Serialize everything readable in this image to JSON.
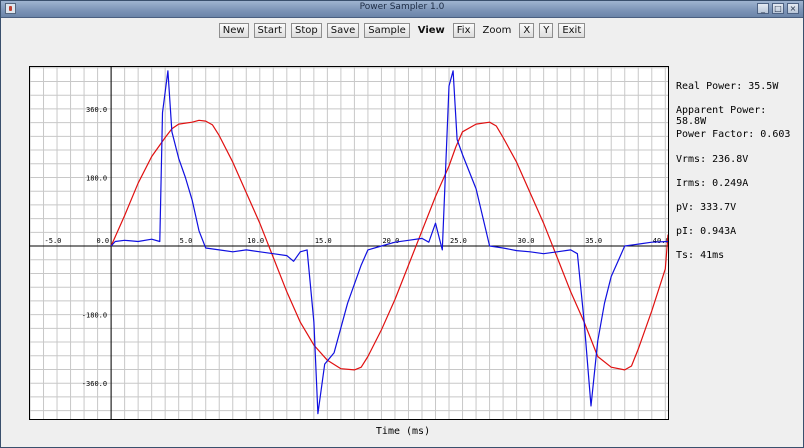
{
  "window": {
    "title": "Power Sampler 1.0",
    "minimize": "_",
    "maximize": "□",
    "close": "×"
  },
  "toolbar": {
    "new": "New",
    "start": "Start",
    "stop": "Stop",
    "save": "Save",
    "sample": "Sample",
    "view_label": "View",
    "fix": "Fix",
    "zoom_label": "Zoom",
    "x": "X",
    "y": "Y",
    "exit": "Exit"
  },
  "readouts": {
    "real_power": "Real Power: 35.5W",
    "apparent_power": "Apparent Power: 58.8W",
    "power_factor": "Power Factor: 0.603",
    "vrms": "Vrms: 236.8V",
    "irms": "Irms: 0.249A",
    "pv": "pV: 333.7V",
    "pi": "pI: 0.943A",
    "ts": "Ts: 41ms"
  },
  "chart_data": {
    "type": "line",
    "xlabel": "Time (ms)",
    "xlim": [
      -6,
      41.2
    ],
    "ylim": [
      -454,
      470
    ],
    "x_ticks": [
      -5,
      0,
      5,
      10,
      15,
      20,
      25,
      30,
      35,
      40
    ],
    "x_tick_labels": [
      "-5.0",
      "0.0",
      "5.0",
      "10.0",
      "15.0",
      "20.0",
      "25.0",
      "30.0",
      "35.0",
      "40.0"
    ],
    "y_ticks": [
      360,
      180,
      -180,
      -360
    ],
    "y_tick_labels": [
      "360.0",
      "180.0",
      "-180.0",
      "-360.0"
    ],
    "origin_label": "0.0",
    "grid": true,
    "series": [
      {
        "color": "#e01010",
        "points": [
          [
            0,
            0
          ],
          [
            1.0,
            80
          ],
          [
            2.0,
            165
          ],
          [
            3.0,
            235
          ],
          [
            4.0,
            285
          ],
          [
            4.5,
            308
          ],
          [
            5.0,
            320
          ],
          [
            6.0,
            325
          ],
          [
            6.5,
            330
          ],
          [
            7.0,
            328
          ],
          [
            7.5,
            318
          ],
          [
            8.0,
            290
          ],
          [
            9.0,
            220
          ],
          [
            10.0,
            140
          ],
          [
            11.0,
            60
          ],
          [
            12.0,
            -30
          ],
          [
            13.0,
            -120
          ],
          [
            14.0,
            -200
          ],
          [
            15.0,
            -260
          ],
          [
            16.0,
            -300
          ],
          [
            17.0,
            -322
          ],
          [
            18.0,
            -325
          ],
          [
            18.5,
            -318
          ],
          [
            19.0,
            -290
          ],
          [
            20.0,
            -220
          ],
          [
            21.0,
            -140
          ],
          [
            22.0,
            -50
          ],
          [
            23.0,
            40
          ],
          [
            24.0,
            130
          ],
          [
            25.0,
            210
          ],
          [
            25.5,
            260
          ],
          [
            26.0,
            300
          ],
          [
            27.0,
            320
          ],
          [
            28.0,
            325
          ],
          [
            28.5,
            315
          ],
          [
            29.0,
            285
          ],
          [
            30.0,
            220
          ],
          [
            31.0,
            140
          ],
          [
            32.0,
            60
          ],
          [
            33.0,
            -30
          ],
          [
            34.0,
            -120
          ],
          [
            35.0,
            -200
          ],
          [
            35.5,
            -245
          ],
          [
            36.0,
            -290
          ],
          [
            37.0,
            -318
          ],
          [
            38.0,
            -325
          ],
          [
            38.5,
            -315
          ],
          [
            39.0,
            -270
          ],
          [
            40.0,
            -170
          ],
          [
            41.0,
            -60
          ],
          [
            41.2,
            30
          ]
        ]
      },
      {
        "color": "#1010e0",
        "points": [
          [
            0,
            0
          ],
          [
            0.3,
            12
          ],
          [
            1.0,
            15
          ],
          [
            2.0,
            12
          ],
          [
            3.0,
            18
          ],
          [
            3.6,
            12
          ],
          [
            3.8,
            350
          ],
          [
            4.2,
            460
          ],
          [
            4.5,
            300
          ],
          [
            5.0,
            230
          ],
          [
            5.5,
            180
          ],
          [
            6.0,
            120
          ],
          [
            6.5,
            40
          ],
          [
            7.0,
            -5
          ],
          [
            8.0,
            -10
          ],
          [
            9.0,
            -15
          ],
          [
            10.0,
            -10
          ],
          [
            11.0,
            -15
          ],
          [
            12.0,
            -20
          ],
          [
            13.0,
            -25
          ],
          [
            13.5,
            -40
          ],
          [
            14.0,
            -15
          ],
          [
            14.5,
            -10
          ],
          [
            15.0,
            -200
          ],
          [
            15.3,
            -440
          ],
          [
            15.8,
            -310
          ],
          [
            16.5,
            -280
          ],
          [
            17.5,
            -150
          ],
          [
            18.5,
            -50
          ],
          [
            19.0,
            -10
          ],
          [
            20.0,
            0
          ],
          [
            21.0,
            10
          ],
          [
            22.0,
            15
          ],
          [
            23.0,
            20
          ],
          [
            23.5,
            10
          ],
          [
            24.0,
            60
          ],
          [
            24.5,
            -10
          ],
          [
            25.0,
            420
          ],
          [
            25.3,
            460
          ],
          [
            25.6,
            280
          ],
          [
            26.0,
            240
          ],
          [
            27.0,
            150
          ],
          [
            28.0,
            0
          ],
          [
            29.0,
            -5
          ],
          [
            30.0,
            -12
          ],
          [
            31.0,
            -15
          ],
          [
            32.0,
            -20
          ],
          [
            33.0,
            -15
          ],
          [
            34.0,
            -10
          ],
          [
            34.5,
            -20
          ],
          [
            35.0,
            -200
          ],
          [
            35.5,
            -420
          ],
          [
            36.0,
            -250
          ],
          [
            36.5,
            -150
          ],
          [
            37.0,
            -80
          ],
          [
            37.5,
            -40
          ],
          [
            38.0,
            0
          ],
          [
            39.0,
            5
          ],
          [
            40.0,
            10
          ],
          [
            41.2,
            12
          ]
        ]
      }
    ]
  }
}
